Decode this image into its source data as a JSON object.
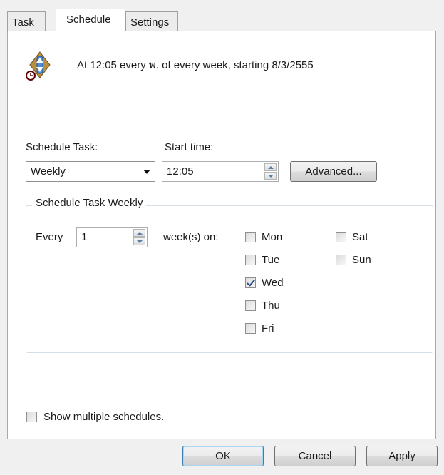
{
  "tabs": [
    {
      "label": "Task"
    },
    {
      "label": "Schedule"
    },
    {
      "label": "Settings"
    }
  ],
  "active_tab": "Schedule",
  "summary": "At 12:05 every พ. of every week, starting 8/3/2555",
  "schedule_task": {
    "label": "Schedule Task:",
    "value": "Weekly"
  },
  "start_time": {
    "label": "Start time:",
    "value": "12:05"
  },
  "advanced_button": "Advanced...",
  "weekly_group": {
    "title": "Schedule Task Weekly",
    "every_label": "Every",
    "every_value": "1",
    "weeks_on_label": "week(s) on:",
    "days": [
      {
        "label": "Mon",
        "checked": false
      },
      {
        "label": "Tue",
        "checked": false
      },
      {
        "label": "Wed",
        "checked": true
      },
      {
        "label": "Thu",
        "checked": false
      },
      {
        "label": "Fri",
        "checked": false
      },
      {
        "label": "Sat",
        "checked": false
      },
      {
        "label": "Sun",
        "checked": false
      }
    ]
  },
  "show_multiple": {
    "label": "Show multiple schedules.",
    "checked": false
  },
  "buttons": {
    "ok": "OK",
    "cancel": "Cancel",
    "apply": "Apply"
  },
  "icons": {
    "task": "scheduled-task-icon",
    "clock": "clock-icon"
  }
}
